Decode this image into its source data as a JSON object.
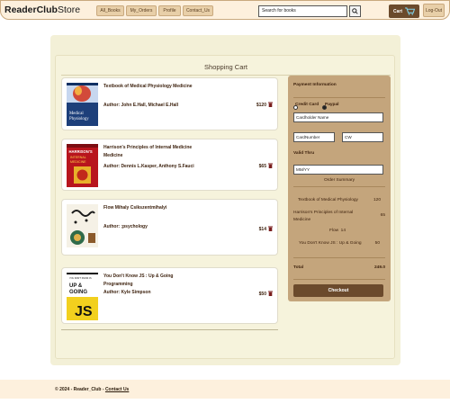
{
  "brand": {
    "name": "ReaderClub",
    "suffix": "Store"
  },
  "nav": {
    "items": [
      {
        "label": "All_Books"
      },
      {
        "label": "My_Orders"
      },
      {
        "label": "Profile"
      },
      {
        "label": "Contact_Us"
      }
    ],
    "search_placeholder": "Search for books",
    "cart_label": "Cart",
    "logout_label": "Log-Out"
  },
  "cart": {
    "title": "Shopping Cart",
    "items": [
      {
        "title": "Textbook of Medical Physiology Medicine",
        "author": "Author: John E.Hall, Michael E.Hall",
        "price": "$120"
      },
      {
        "title": "Harrison's Principles of Internal Medicine Medicine",
        "author": "Author: Dennis L.Kasper, Anthony S.Fauci",
        "price": "$65"
      },
      {
        "title": "Flow Mihaly Csikszentmihalyi",
        "author": "Author: ;psychology",
        "price": "$14"
      },
      {
        "title": "You Don't Know JS : Up & Going Programming",
        "author": "Author: Kyle Simpson",
        "price": "$50"
      }
    ]
  },
  "payment": {
    "title": "Payment Information",
    "methods": [
      "Credit Card",
      "Paypal"
    ],
    "cardholder_placeholder": "Cardholder Name",
    "cardnumber_placeholder": "CardNumber",
    "cvv_placeholder": "CW",
    "valid_thru_label": "Valid Thru",
    "expiry_placeholder": "MM/YY",
    "summary_title": "Order Summary",
    "summary": [
      {
        "name": "Textbook of Medical Physiology",
        "value": "120"
      },
      {
        "name": "Harrison's Principles of Internal Medicine",
        "value": "65"
      },
      {
        "name": "Flow",
        "value": "14"
      },
      {
        "name": "You Don't Know JS : Up & Going",
        "value": "50"
      }
    ],
    "total_label": "Total",
    "total_value": "249.0",
    "checkout_label": "Checkout"
  },
  "footer": {
    "text": "© 2024 - Reader_Club - ",
    "link": "Contact Us"
  },
  "colors": {
    "accent": "#6b4a2c",
    "nav_bg": "#fdf0dd",
    "panel": "#c4a57c",
    "page": "#f3f0d7"
  }
}
